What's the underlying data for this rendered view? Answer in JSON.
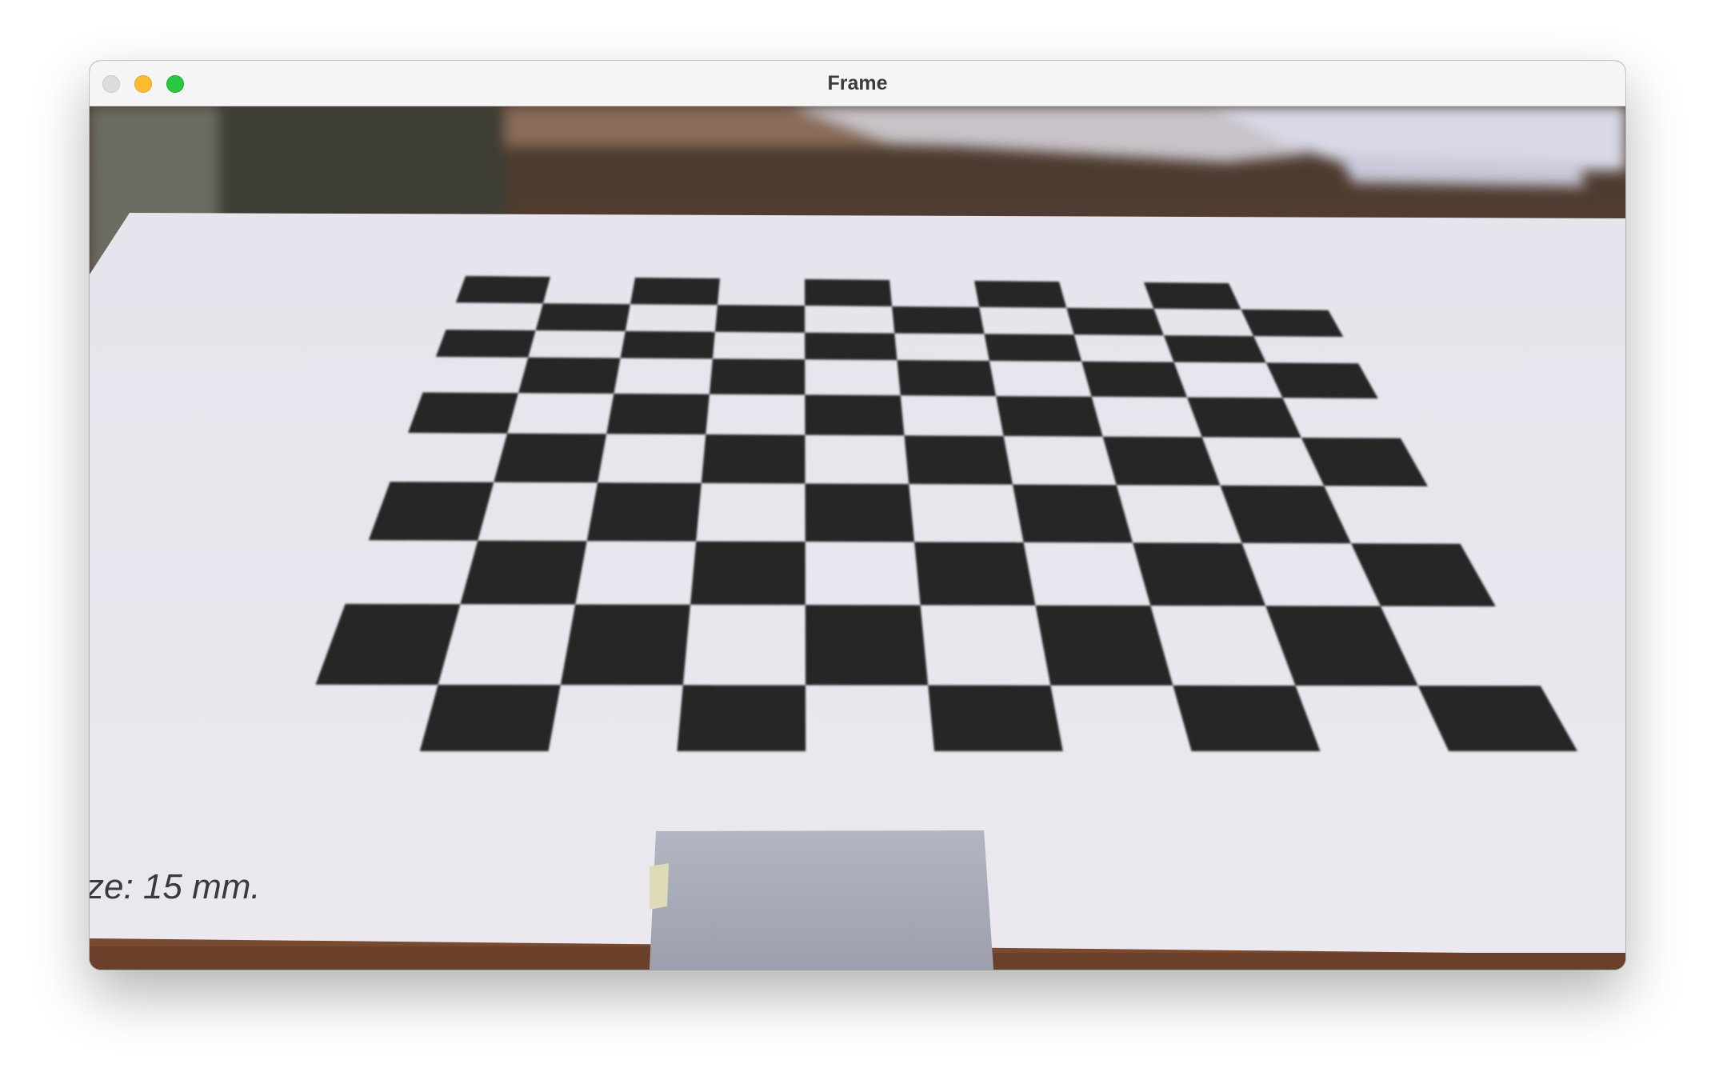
{
  "window": {
    "title": "Frame",
    "controls": [
      "close",
      "minimize",
      "zoom"
    ]
  },
  "frame": {
    "caption": "ze: 15 mm.",
    "subject": "checkerboard calibration pattern",
    "colors": {
      "board_square": "#262626",
      "paper": "#e9e7ee",
      "desk": "#6b3f2a",
      "foam": "#a9acb9"
    }
  }
}
